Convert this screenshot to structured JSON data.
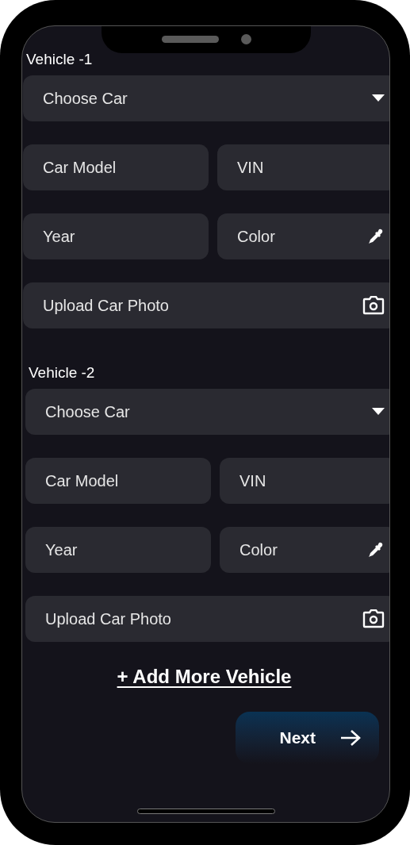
{
  "vehicles": [
    {
      "title": "Vehicle -1",
      "fields": [
        {
          "kind": "dropdown",
          "placeholder": "Choose Car"
        },
        {
          "kind": "text",
          "placeholder": "Car Model"
        },
        {
          "kind": "text",
          "placeholder": "VIN"
        },
        {
          "kind": "text",
          "placeholder": "Year"
        },
        {
          "kind": "color",
          "placeholder": "Color"
        },
        {
          "kind": "upload",
          "placeholder": "Upload Car Photo"
        }
      ]
    },
    {
      "title": "Vehicle -2",
      "fields": [
        {
          "kind": "dropdown",
          "placeholder": "Choose Car"
        },
        {
          "kind": "text",
          "placeholder": "Car Model"
        },
        {
          "kind": "text",
          "placeholder": "VIN"
        },
        {
          "kind": "text",
          "placeholder": "Year"
        },
        {
          "kind": "color",
          "placeholder": "Color"
        },
        {
          "kind": "upload",
          "placeholder": "Upload Car Photo"
        }
      ]
    }
  ],
  "add_link": "+ Add More Vehicle",
  "next_button": "Next"
}
